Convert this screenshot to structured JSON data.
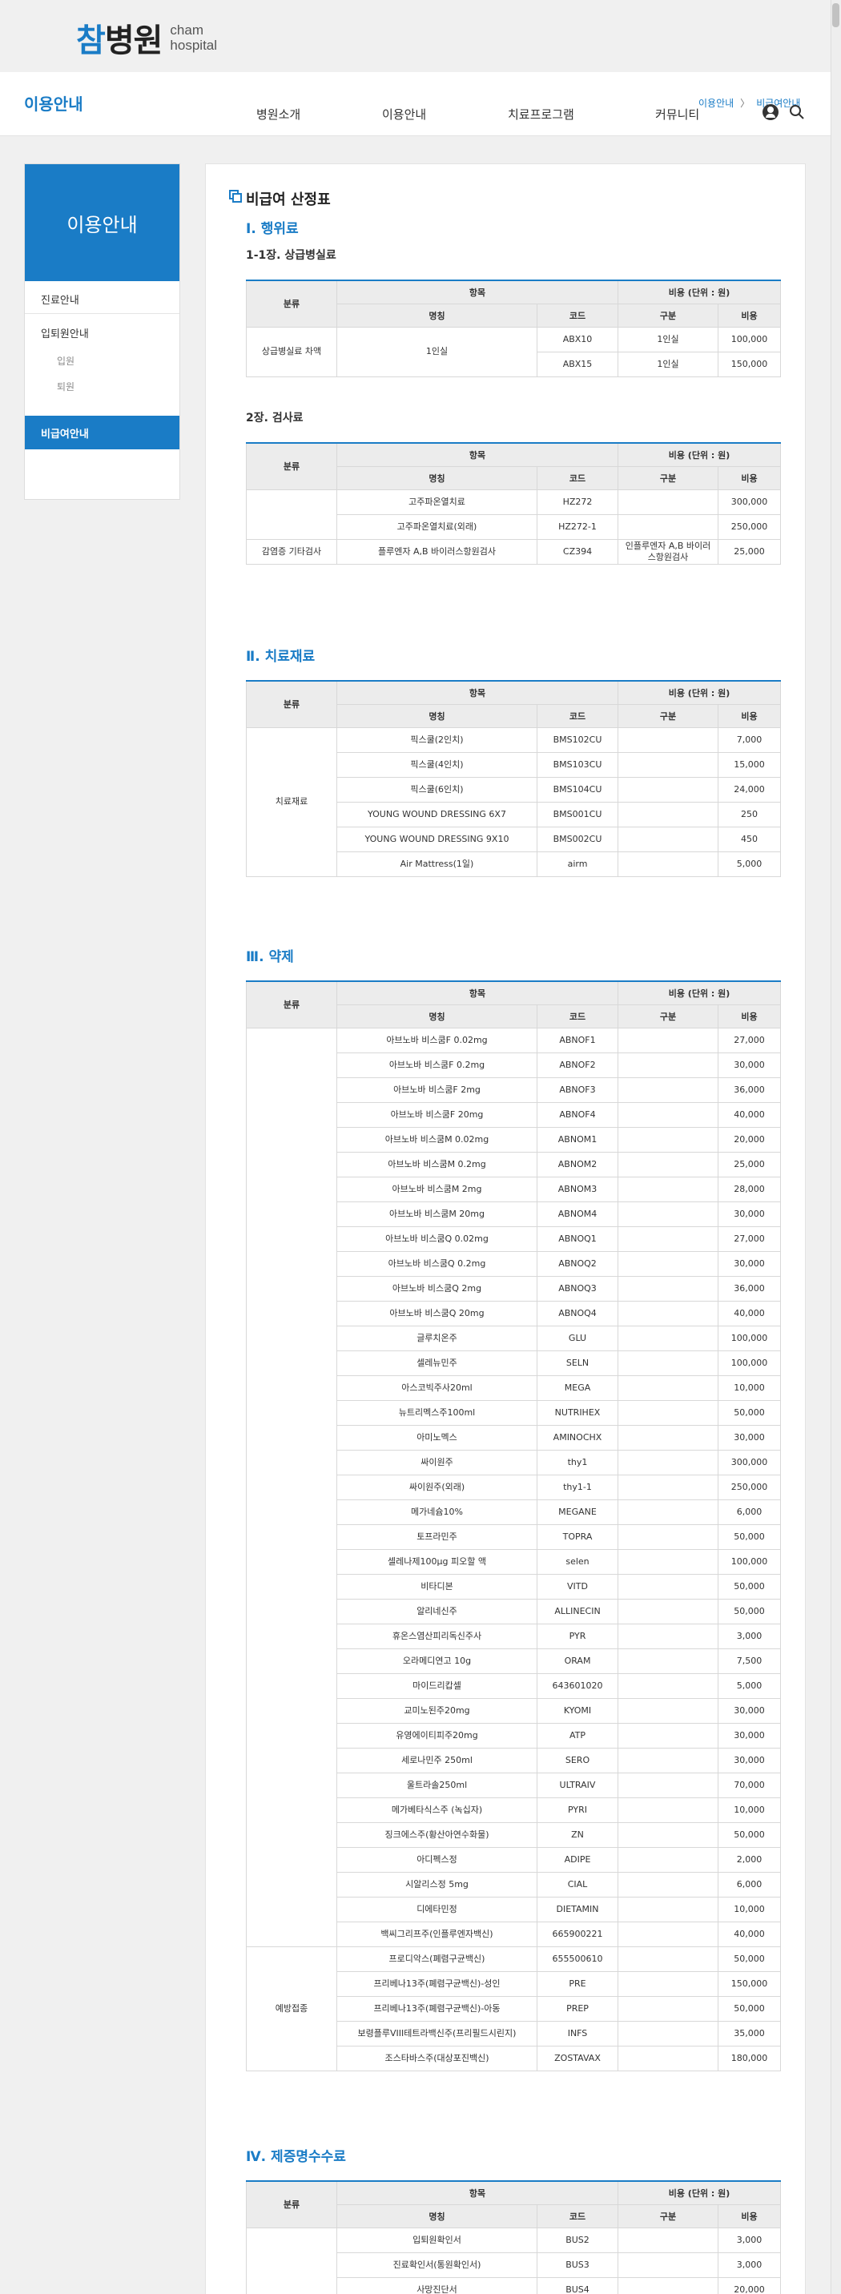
{
  "header": {
    "logo_char1": "참",
    "logo_char2": "병원",
    "logo_sub_line1": "cham",
    "logo_sub_line2": "hospital"
  },
  "nav": {
    "section_title": "이용안내",
    "items": [
      "병원소개",
      "이용안내",
      "치료프로그램",
      "커뮤니티"
    ],
    "breadcrumb": [
      "이용안내",
      "비급여안내"
    ]
  },
  "sidebar": {
    "title": "이용안내",
    "items": [
      "진료안내",
      "입퇴원안내",
      "입원",
      "퇴원",
      "비급여안내"
    ]
  },
  "page": {
    "title": "비급여 산정표"
  },
  "table_header": {
    "category": "분류",
    "item": "항목",
    "cost": "비용 (단위 : 원)",
    "name": "명칭",
    "code": "코드",
    "division": "구분",
    "price": "비용"
  },
  "sections": [
    {
      "title": "Ⅰ. 행위료",
      "subtables": [
        {
          "subtitle": "1-1장. 상급병실료",
          "groups": [
            {
              "label": "상급병실료 차액",
              "rows": [
                {
                  "name": "1인실",
                  "code": "ABX10",
                  "div": "1인실",
                  "price": "100,000"
                },
                {
                  "name": "",
                  "code": "ABX15",
                  "div": "1인실",
                  "price": "150,000"
                }
              ]
            }
          ]
        },
        {
          "subtitle": "2장. 검사료",
          "groups": [
            {
              "label": "",
              "rows": [
                {
                  "name": "고주파온열치료",
                  "code": "HZ272",
                  "div": "",
                  "price": "300,000"
                },
                {
                  "name": "고주파온열치료(외래)",
                  "code": "HZ272-1",
                  "div": "",
                  "price": "250,000"
                }
              ]
            },
            {
              "label": "감염증 기타검사",
              "rows": [
                {
                  "name": "플루엔자 A,B 바이러스항원검사",
                  "code": "CZ394",
                  "div": "인플루엔자 A,B 바이러스항원검사",
                  "price": "25,000"
                }
              ]
            }
          ]
        }
      ]
    },
    {
      "title": "Ⅱ. 치료재료",
      "subtables": [
        {
          "subtitle": "",
          "groups": [
            {
              "label": "치료재료",
              "rows": [
                {
                  "name": "픽스쿨(2인치)",
                  "code": "BMS102CU",
                  "div": "",
                  "price": "7,000"
                },
                {
                  "name": "픽스쿨(4인치)",
                  "code": "BMS103CU",
                  "div": "",
                  "price": "15,000"
                },
                {
                  "name": "픽스쿨(6인치)",
                  "code": "BMS104CU",
                  "div": "",
                  "price": "24,000"
                },
                {
                  "name": "YOUNG WOUND DRESSING 6X7",
                  "code": "BMS001CU",
                  "div": "",
                  "price": "250"
                },
                {
                  "name": "YOUNG WOUND DRESSING 9X10",
                  "code": "BMS002CU",
                  "div": "",
                  "price": "450"
                },
                {
                  "name": "Air Mattress(1일)",
                  "code": "airm",
                  "div": "",
                  "price": "5,000"
                }
              ]
            }
          ]
        }
      ]
    },
    {
      "title": "Ⅲ. 약제",
      "subtables": [
        {
          "subtitle": "",
          "groups": [
            {
              "label": "",
              "rows": [
                {
                  "name": "아브노바 비스쿰F 0.02mg",
                  "code": "ABNOF1",
                  "div": "",
                  "price": "27,000"
                },
                {
                  "name": "아브노바 비스쿰F 0.2mg",
                  "code": "ABNOF2",
                  "div": "",
                  "price": "30,000"
                },
                {
                  "name": "아브노바 비스쿰F 2mg",
                  "code": "ABNOF3",
                  "div": "",
                  "price": "36,000"
                },
                {
                  "name": "아브노바 비스쿰F 20mg",
                  "code": "ABNOF4",
                  "div": "",
                  "price": "40,000"
                },
                {
                  "name": "아브노바 비스쿰M 0.02mg",
                  "code": "ABNOM1",
                  "div": "",
                  "price": "20,000"
                },
                {
                  "name": "아브노바 비스쿰M 0.2mg",
                  "code": "ABNOM2",
                  "div": "",
                  "price": "25,000"
                },
                {
                  "name": "아브노바 비스쿰M 2mg",
                  "code": "ABNOM3",
                  "div": "",
                  "price": "28,000"
                },
                {
                  "name": "아브노바 비스쿰M 20mg",
                  "code": "ABNOM4",
                  "div": "",
                  "price": "30,000"
                },
                {
                  "name": "아브노바 비스쿰Q 0.02mg",
                  "code": "ABNOQ1",
                  "div": "",
                  "price": "27,000"
                },
                {
                  "name": "아브노바 비스쿰Q 0.2mg",
                  "code": "ABNOQ2",
                  "div": "",
                  "price": "30,000"
                },
                {
                  "name": "아브노바 비스쿰Q 2mg",
                  "code": "ABNOQ3",
                  "div": "",
                  "price": "36,000"
                },
                {
                  "name": "아브노바 비스쿰Q 20mg",
                  "code": "ABNOQ4",
                  "div": "",
                  "price": "40,000"
                },
                {
                  "name": "글루치온주",
                  "code": "GLU",
                  "div": "",
                  "price": "100,000"
                },
                {
                  "name": "셀레뉴민주",
                  "code": "SELN",
                  "div": "",
                  "price": "100,000"
                },
                {
                  "name": "아스코빅주사20ml",
                  "code": "MEGA",
                  "div": "",
                  "price": "10,000"
                },
                {
                  "name": "뉴트리멕스주100ml",
                  "code": "NUTRIHEX",
                  "div": "",
                  "price": "50,000"
                },
                {
                  "name": "아미노멕스",
                  "code": "AMINOCHX",
                  "div": "",
                  "price": "30,000"
                },
                {
                  "name": "싸이원주",
                  "code": "thy1",
                  "div": "",
                  "price": "300,000"
                },
                {
                  "name": "싸이원주(외래)",
                  "code": "thy1-1",
                  "div": "",
                  "price": "250,000"
                },
                {
                  "name": "메가네슘10%",
                  "code": "MEGANE",
                  "div": "",
                  "price": "6,000"
                },
                {
                  "name": "토프라민주",
                  "code": "TOPRA",
                  "div": "",
                  "price": "50,000"
                },
                {
                  "name": "셀레나제100μg 피오할 액",
                  "code": "selen",
                  "div": "",
                  "price": "100,000"
                },
                {
                  "name": "비타디본",
                  "code": "VITD",
                  "div": "",
                  "price": "50,000"
                },
                {
                  "name": "알리네신주",
                  "code": "ALLINECIN",
                  "div": "",
                  "price": "50,000"
                },
                {
                  "name": "휴온스염산피리독신주사",
                  "code": "PYR",
                  "div": "",
                  "price": "3,000"
                },
                {
                  "name": "오라메디연고 10g",
                  "code": "ORAM",
                  "div": "",
                  "price": "7,500"
                },
                {
                  "name": "마이드리캅셀",
                  "code": "643601020",
                  "div": "",
                  "price": "5,000"
                },
                {
                  "name": "교미노된주20mg",
                  "code": "KYOMI",
                  "div": "",
                  "price": "30,000"
                },
                {
                  "name": "유영에이티피주20mg",
                  "code": "ATP",
                  "div": "",
                  "price": "30,000"
                },
                {
                  "name": "세로나민주 250ml",
                  "code": "SERO",
                  "div": "",
                  "price": "30,000"
                },
                {
                  "name": "울트라솔250ml",
                  "code": "ULTRAIV",
                  "div": "",
                  "price": "70,000"
                },
                {
                  "name": "메가베타식스주 (녹십자)",
                  "code": "PYRI",
                  "div": "",
                  "price": "10,000"
                },
                {
                  "name": "징크에스주(황산아연수화물)",
                  "code": "ZN",
                  "div": "",
                  "price": "50,000"
                },
                {
                  "name": "아디펙스정",
                  "code": "ADIPE",
                  "div": "",
                  "price": "2,000"
                },
                {
                  "name": "시알리스정 5mg",
                  "code": "CIAL",
                  "div": "",
                  "price": "6,000"
                },
                {
                  "name": "디에타민정",
                  "code": "DIETAMIN",
                  "div": "",
                  "price": "10,000"
                },
                {
                  "name": "백씨그리프주(인플루엔자백신)",
                  "code": "665900221",
                  "div": "",
                  "price": "40,000"
                }
              ]
            },
            {
              "label": "예방접종",
              "rows": [
                {
                  "name": "프로디악스(폐렴구균백신)",
                  "code": "655500610",
                  "div": "",
                  "price": "50,000"
                },
                {
                  "name": "프리베나13주(폐렴구균백신)-성인",
                  "code": "PRE",
                  "div": "",
                  "price": "150,000"
                },
                {
                  "name": "프리베나13주(폐렴구균백신)-아동",
                  "code": "PREP",
                  "div": "",
                  "price": "50,000"
                },
                {
                  "name": "보령플루VIII테트라백신주(프리필드시린지)",
                  "code": "INFS",
                  "div": "",
                  "price": "35,000"
                },
                {
                  "name": "조스타바스주(대상포진백신)",
                  "code": "ZOSTAVAX",
                  "div": "",
                  "price": "180,000"
                }
              ]
            }
          ]
        }
      ]
    },
    {
      "title": "Ⅳ. 제증명수수료",
      "subtables": [
        {
          "subtitle": "",
          "groups": [
            {
              "label": "",
              "rows": [
                {
                  "name": "입퇴원확인서",
                  "code": "BUS2",
                  "div": "",
                  "price": "3,000"
                },
                {
                  "name": "진료확인서(통원확인서)",
                  "code": "BUS3",
                  "div": "",
                  "price": "3,000"
                },
                {
                  "name": "사망진단서",
                  "code": "BUS4",
                  "div": "",
                  "price": "20,000"
                }
              ]
            }
          ]
        }
      ]
    }
  ]
}
